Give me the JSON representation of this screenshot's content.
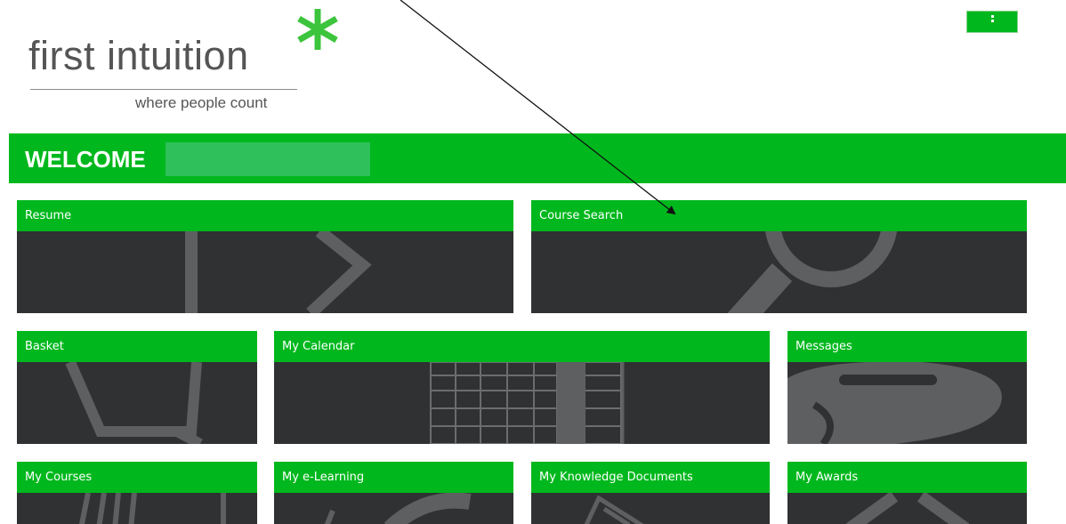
{
  "logo": {
    "name": "first intuition",
    "tagline": "where people count",
    "icon": "asterisk-logo-icon",
    "star_color": "#3cc43c"
  },
  "menu": {
    "icon": "vertical-dots-icon"
  },
  "welcome": {
    "text": "WELCOME",
    "bar_color": "#00b81d"
  },
  "tiles": [
    {
      "label": "Resume",
      "icon": "resume-icon"
    },
    {
      "label": "Course Search",
      "icon": "magnifier-icon"
    },
    {
      "label": "Basket",
      "icon": "basket-icon"
    },
    {
      "label": "My Calendar",
      "icon": "calendar-icon"
    },
    {
      "label": "Messages",
      "icon": "speech-bubble-icon"
    },
    {
      "label": "My Courses",
      "icon": "courses-icon"
    },
    {
      "label": "My e-Learning",
      "icon": "e-learning-icon"
    },
    {
      "label": "My Knowledge Documents",
      "icon": "documents-icon"
    },
    {
      "label": "My Awards",
      "icon": "awards-icon"
    }
  ],
  "colors": {
    "brand_green": "#00b81d",
    "tile_dark": "#2f3133",
    "icon_grey": "#5d5f61"
  }
}
